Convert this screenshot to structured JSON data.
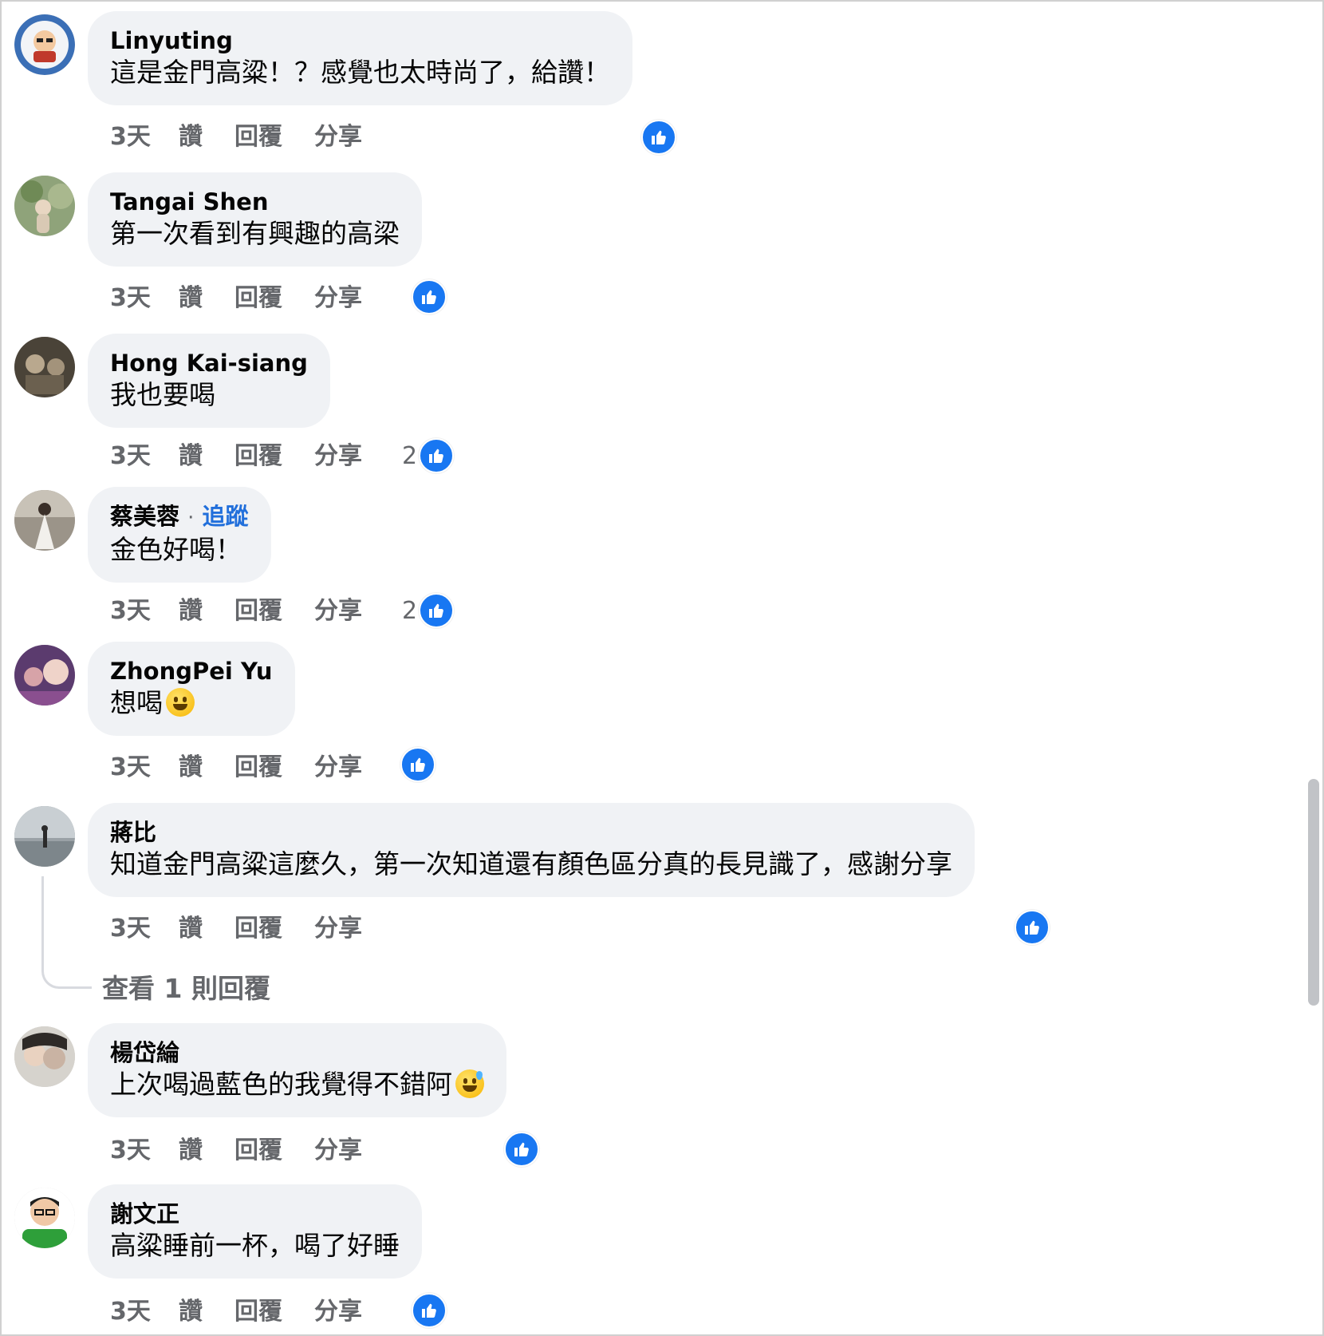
{
  "comments": [
    {
      "author": "Linyuting",
      "text": "這是金門高粱！？感覺也太時尚了，給讚！",
      "time": "3天",
      "like": "讚",
      "reply": "回覆",
      "share": "分享",
      "reaction_count": ""
    },
    {
      "author": "Tangai Shen",
      "text": "第一次看到有興趣的高梁",
      "time": "3天",
      "like": "讚",
      "reply": "回覆",
      "share": "分享",
      "reaction_count": ""
    },
    {
      "author": "Hong Kai-siang",
      "text": "我也要喝",
      "time": "3天",
      "like": "讚",
      "reply": "回覆",
      "share": "分享",
      "reaction_count": "2"
    },
    {
      "author": "蔡美蓉",
      "follow_sep": "·",
      "follow": "追蹤",
      "text": "金色好喝！",
      "time": "3天",
      "like": "讚",
      "reply": "回覆",
      "share": "分享",
      "reaction_count": "2"
    },
    {
      "author": "ZhongPei Yu",
      "text": "想喝",
      "time": "3天",
      "like": "讚",
      "reply": "回覆",
      "share": "分享",
      "reaction_count": ""
    },
    {
      "author": "蔣比",
      "text": "知道金門高粱這麼久，第一次知道還有顏色區分真的長見識了，感謝分享",
      "time": "3天",
      "like": "讚",
      "reply": "回覆",
      "share": "分享",
      "reaction_count": ""
    },
    {
      "author": "楊岱綸",
      "text": "上次喝過藍色的我覺得不錯阿",
      "time": "3天",
      "like": "讚",
      "reply": "回覆",
      "share": "分享",
      "reaction_count": ""
    },
    {
      "author": "謝文正",
      "text": "高粱睡前一杯，喝了好睡",
      "time": "3天",
      "like": "讚",
      "reply": "回覆",
      "share": "分享",
      "reaction_count": ""
    }
  ],
  "view_replies": "查看 1 則回覆",
  "colors": {
    "bubble": "#f0f2f5",
    "like_blue": "#1877f2",
    "follow_blue": "#216fdb",
    "meta_gray": "#65676b"
  },
  "icons": {
    "reaction": "like-thumb-icon",
    "emoji_smile": "grinning-face-emoji",
    "emoji_sweat": "grinning-sweat-emoji"
  }
}
